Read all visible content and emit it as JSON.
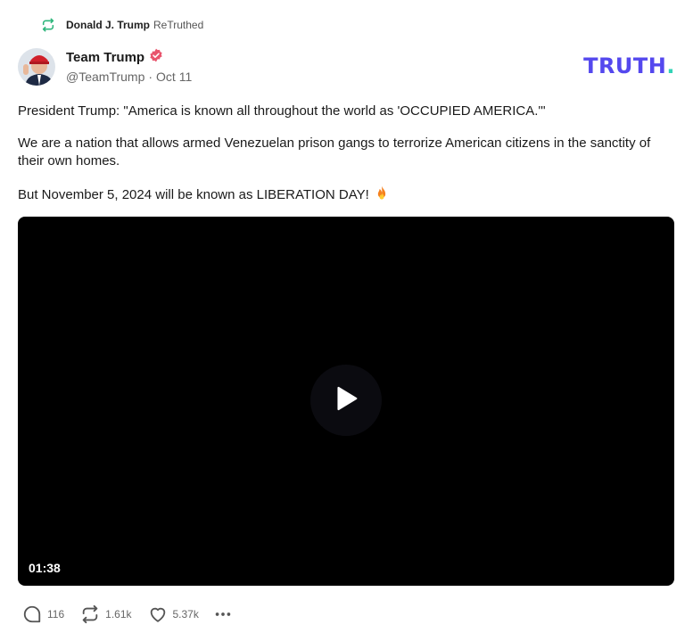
{
  "retruth": {
    "name": "Donald J. Trump",
    "label": "ReTruthed"
  },
  "author": {
    "name": "Team Trump",
    "handle": "@TeamTrump",
    "separator": "·",
    "date": "Oct 11",
    "verified": true
  },
  "logo": {
    "text": "TRUTH",
    "dot": ".",
    "colors": {
      "text": "#5448ee",
      "dot": "#32d3b6"
    }
  },
  "post": {
    "paragraphs": [
      "President Trump: \"America is known all throughout the world as 'OCCUPIED AMERICA.'\"",
      "We are a nation that allows armed Venezuelan prison gangs to terrorize American citizens in the sanctity of their own homes.",
      "But November 5, 2024 will be known as LIBERATION DAY!"
    ],
    "emoji_icon": "fire-icon"
  },
  "video": {
    "duration": "01:38"
  },
  "actions": {
    "replies": "116",
    "retruths": "1.61k",
    "likes": "5.37k"
  },
  "colors": {
    "retruth_green": "#2fb67c",
    "verified_badge": "#e8546c",
    "muted_text": "#666666"
  }
}
